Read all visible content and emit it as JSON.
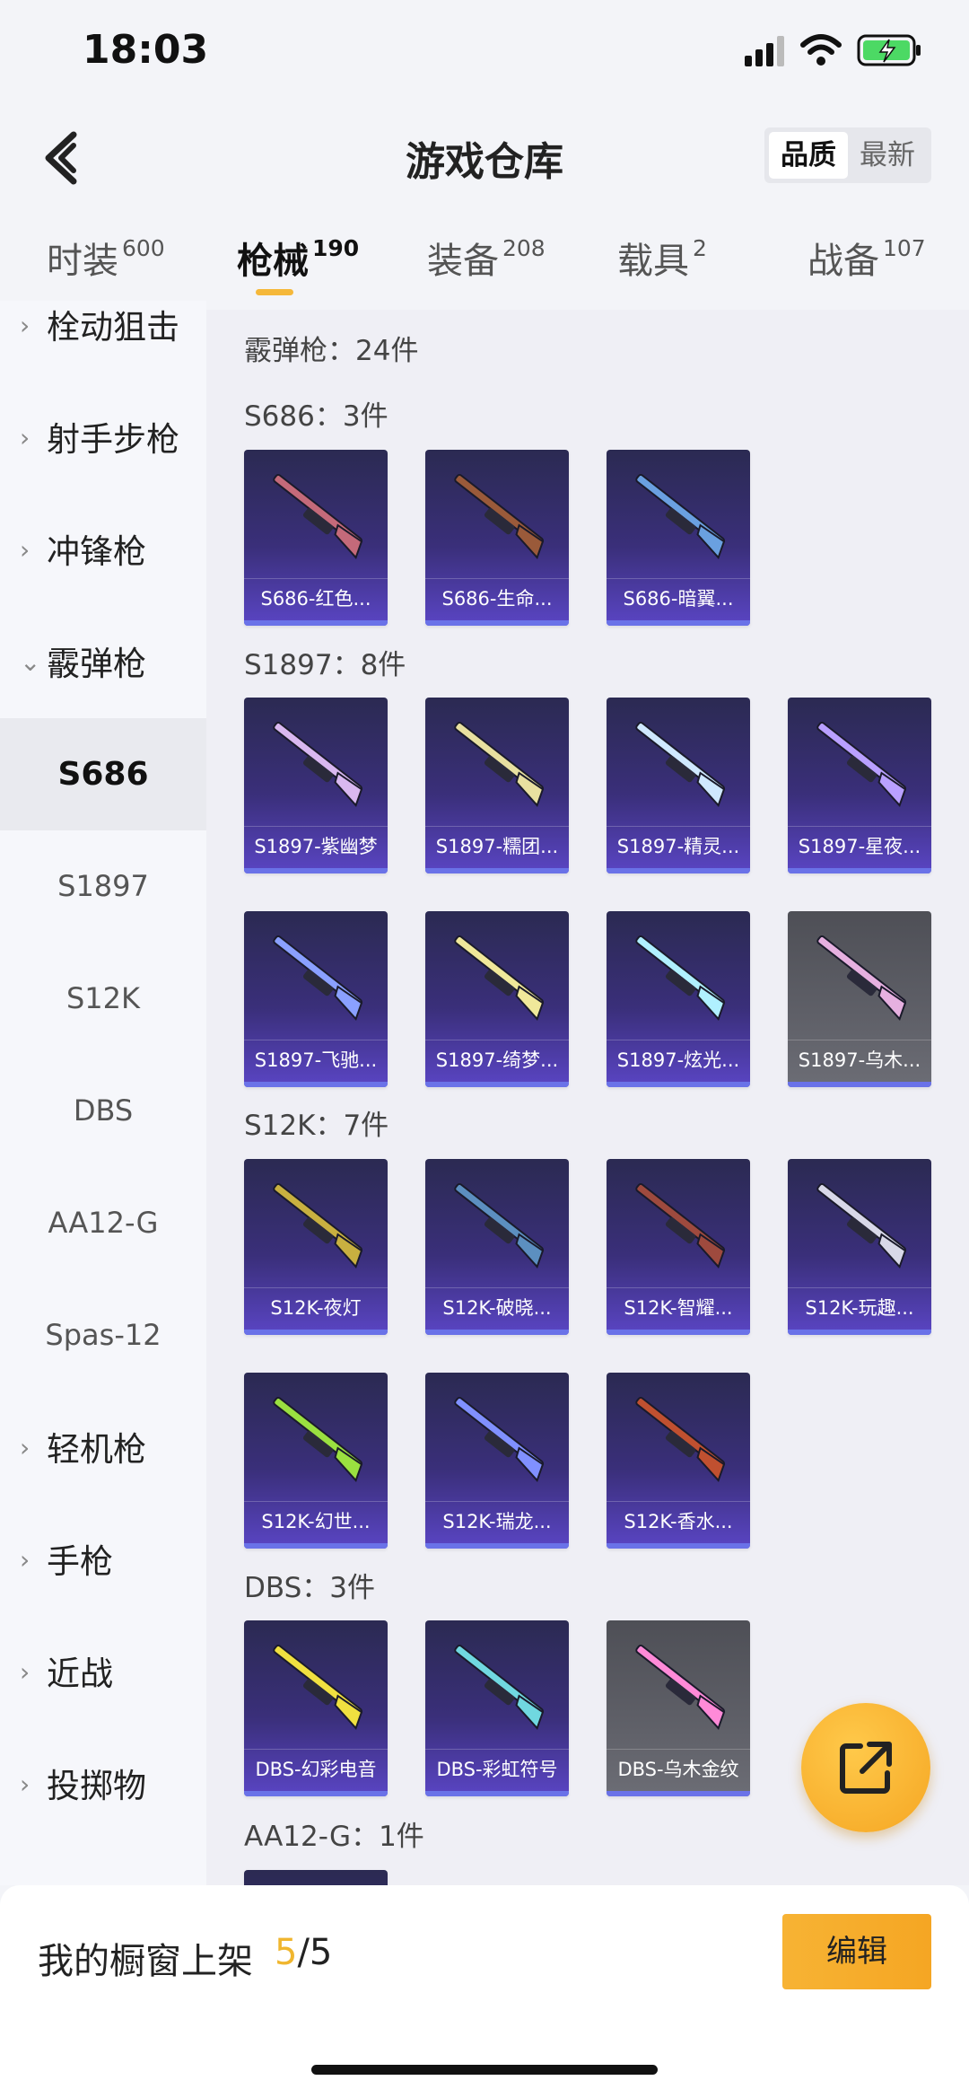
{
  "status_bar": {
    "time": "18:03"
  },
  "header": {
    "title": "游戏仓库",
    "sort": [
      "品质",
      "最新"
    ]
  },
  "tabs": [
    {
      "label": "时装",
      "count": "600"
    },
    {
      "label": "枪械",
      "count": "190"
    },
    {
      "label": "装备",
      "count": "208"
    },
    {
      "label": "载具",
      "count": "2"
    },
    {
      "label": "战备",
      "count": "107"
    }
  ],
  "sidebar": {
    "groups": [
      "栓动狙击",
      "射手步枪",
      "冲锋枪",
      "霰弹枪",
      "轻机枪",
      "手枪",
      "近战",
      "投掷物"
    ],
    "subs": [
      "S686",
      "S1897",
      "S12K",
      "DBS",
      "AA12-G",
      "Spas-12"
    ]
  },
  "content": {
    "category": "霰弹枪：24件",
    "sections": [
      {
        "title": "S686：3件",
        "items": [
          "S686-红色...",
          "S686-生命...",
          "S686-暗翼..."
        ]
      },
      {
        "title": "S1897：8件",
        "items": [
          "S1897-紫幽梦",
          "S1897-糯团...",
          "S1897-精灵...",
          "S1897-星夜...",
          "S1897-飞驰...",
          "S1897-绮梦...",
          "S1897-炫光...",
          "S1897-乌木..."
        ]
      },
      {
        "title": "S12K：7件",
        "items": [
          "S12K-夜灯",
          "S12K-破晓...",
          "S12K-智耀...",
          "S12K-玩趣...",
          "S12K-幻世...",
          "S12K-瑞龙...",
          "S12K-香水..."
        ]
      },
      {
        "title": "DBS：3件",
        "items": [
          "DBS-幻彩电音",
          "DBS-彩虹符号",
          "DBS-乌木金纹"
        ]
      },
      {
        "title": "AA12-G：1件"
      }
    ]
  },
  "footer": {
    "label": "我的橱窗上架",
    "count_current": "5",
    "count_total": "/5",
    "edit": "编辑"
  },
  "colors": {
    "accent": "#f5b83a",
    "card_purple": "#3a2f7a",
    "card_gray": "#5f6068"
  },
  "icons": [
    "back-icon",
    "share-icon",
    "chevron-right-icon",
    "chevron-down-icon",
    "signal-icon",
    "wifi-icon",
    "battery-icon"
  ]
}
